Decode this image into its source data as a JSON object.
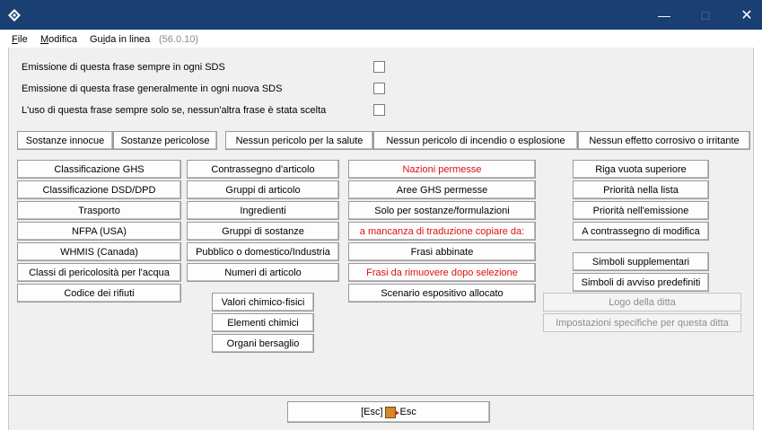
{
  "menu": {
    "file_prefix": "",
    "file_underlined": "F",
    "file_rest": "ile",
    "modifica_underlined": "M",
    "modifica_rest": "odifica",
    "guida_prefix": "Gu",
    "guida_underlined": "i",
    "guida_rest": "da in linea",
    "version": "(56.0.10)"
  },
  "checkboxes": [
    {
      "label": "Emissione di questa frase sempre in ogni SDS",
      "checked": false
    },
    {
      "label": "Emissione di questa frase generalmente in ogni nuova SDS",
      "checked": false
    },
    {
      "label": "L'uso di questa frase sempre solo se, nessun'altra frase è stata scelta",
      "checked": false
    }
  ],
  "top_buttons": [
    "Sostanze innocue",
    "Sostanze pericolose",
    "Nessun pericolo per la salute",
    "Nessun pericolo di incendio o esplosione",
    "Nessun effetto corrosivo o irritante"
  ],
  "col1": [
    "Classificazione GHS",
    "Classificazione DSD/DPD",
    "Trasporto",
    "NFPA (USA)",
    "WHMIS (Canada)",
    "Classi di pericolosità per l'acqua",
    "Codice dei rifiuti"
  ],
  "col2": [
    "Contrassegno d'articolo",
    "Gruppi di articolo",
    "Ingredienti",
    "Gruppi di sostanze",
    "Pubblico o domestico/Industria",
    "Numeri di articolo"
  ],
  "col2b": [
    "Valori chimico-fisici",
    "Elementi chimici",
    "Organi bersaglio"
  ],
  "col3": [
    "Nazioni permesse",
    "Aree GHS permesse",
    "Solo per sostanze/formulazioni",
    "a mancanza di traduzione copiare da:",
    "Frasi abbinate",
    "Frasi da rimuovere dopo selezione",
    "Scenario espositivo allocato"
  ],
  "col4a": [
    "Riga vuota superiore",
    "Priorità nella lista",
    "Priorità nell'emissione",
    "A contrassegno di modifica"
  ],
  "col4b": [
    "Simboli supplementari",
    "Simboli di avviso predefiniti"
  ],
  "col4c": [
    "Logo della ditta",
    "Impostazioni specifiche per questa ditta"
  ],
  "footer": {
    "esc_prefix": "[Esc]",
    "esc_label": "Esc"
  },
  "colors": {
    "titlebar": "#1a3f73",
    "red_text": "#e01010",
    "panel": "#f0f0f0"
  },
  "icons": {
    "app": "app-diamond-icon",
    "minimize": "minimize-icon",
    "maximize": "maximize-icon",
    "close": "close-icon",
    "exit": "exit-door-icon"
  }
}
